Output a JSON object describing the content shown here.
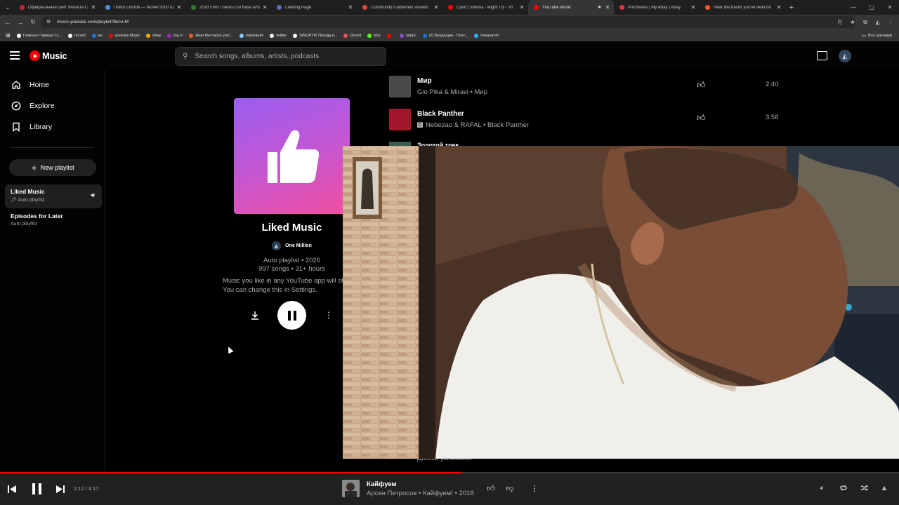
{
  "browser": {
    "tabs": [
      {
        "title": "Официальный сайт VAVADA C",
        "color": "#c62828"
      },
      {
        "title": "Поиск слотов — более 5000 ш",
        "color": "#4a90e2"
      },
      {
        "title": "2018 Ford Transit-150 Base w/S",
        "color": "#2e7d32"
      },
      {
        "title": "Landing Page",
        "color": "#5c6bc0"
      },
      {
        "title": "Community Guidelines Violatio",
        "color": "#ea4335"
      },
      {
        "title": "Cport Cistema - Might Try - Yo",
        "color": "#ff0000"
      },
      {
        "title": "YouTube Music",
        "color": "#ff0000",
        "active": true
      },
      {
        "title": "Purchases | My eBay | eBay",
        "color": "#e53238"
      },
      {
        "title": "Hear the tracks you've liked on",
        "color": "#ff5722"
      }
    ],
    "url": "music.youtube.com/playlist?list=LM",
    "bookmarks": [
      {
        "label": "Главная Главная Гл...",
        "color": "#ffffff"
      },
      {
        "label": "record",
        "color": "#ffffff"
      },
      {
        "label": "ee",
        "color": "#1976d2"
      },
      {
        "label": "youtube Music",
        "color": "#ff0000"
      },
      {
        "label": "ebay",
        "color": "#f5af02"
      },
      {
        "label": "log in",
        "color": "#9c27b0"
      },
      {
        "label": "Hear the tracks you'...",
        "color": "#ff5722"
      },
      {
        "label": "manhaeim",
        "color": "#90caf9"
      },
      {
        "label": "twitter",
        "color": "#ffffff"
      },
      {
        "label": "SINOPTIK Погода в...",
        "color": "#ffffff"
      },
      {
        "label": "Dicord",
        "color": "#ef5350"
      },
      {
        "label": "kick",
        "color": "#53fc18"
      },
      {
        "label": "",
        "color": "#ff0000"
      },
      {
        "label": "опрос",
        "color": "#7e57c2"
      },
      {
        "label": "(2) Входящие - Почт...",
        "color": "#1976d2"
      },
      {
        "label": "telegramm",
        "color": "#29b6f6"
      }
    ],
    "all_bookmarks": "Все закладки"
  },
  "header": {
    "logo_text": "Music",
    "search_placeholder": "Search songs, albums, artists, podcasts"
  },
  "sidebar": {
    "nav": [
      {
        "label": "Home",
        "icon": "home-icon"
      },
      {
        "label": "Explore",
        "icon": "explore-icon"
      },
      {
        "label": "Library",
        "icon": "library-icon"
      }
    ],
    "new_playlist": "New playlist",
    "playlists": [
      {
        "title": "Liked Music",
        "subtitle": "Auto playlist",
        "pinned": true,
        "playing": true
      },
      {
        "title": "Episodes for Later",
        "subtitle": "Auto playlist"
      }
    ]
  },
  "playlist": {
    "name": "Liked Music",
    "owner": "One Million",
    "meta1": "Auto playlist • 2026",
    "meta2": "997 songs • 31+ hours",
    "description": "Music you like in any YouTube app will show up here. You can change this in Settings."
  },
  "tracks": [
    {
      "title": "Мир",
      "subtitle": "Gio Pika & Miravi • Мир",
      "explicit": false,
      "duration": "2:40",
      "thumb": "#4a4a4a"
    },
    {
      "title": "Black Panther",
      "subtitle": "Nebezao & RAFAL • Black Panther",
      "explicit": true,
      "duration": "3:58",
      "thumb": "#a3172d"
    }
  ],
  "partial_track_title": "Золотой трек",
  "under_caption": "Диана, успокойся",
  "player": {
    "time": "2:12 / 4:17",
    "progress": 0.513,
    "title": "Кайфуем",
    "subtitle": "Арсен Петросов • Кайфуем! • 2018"
  }
}
